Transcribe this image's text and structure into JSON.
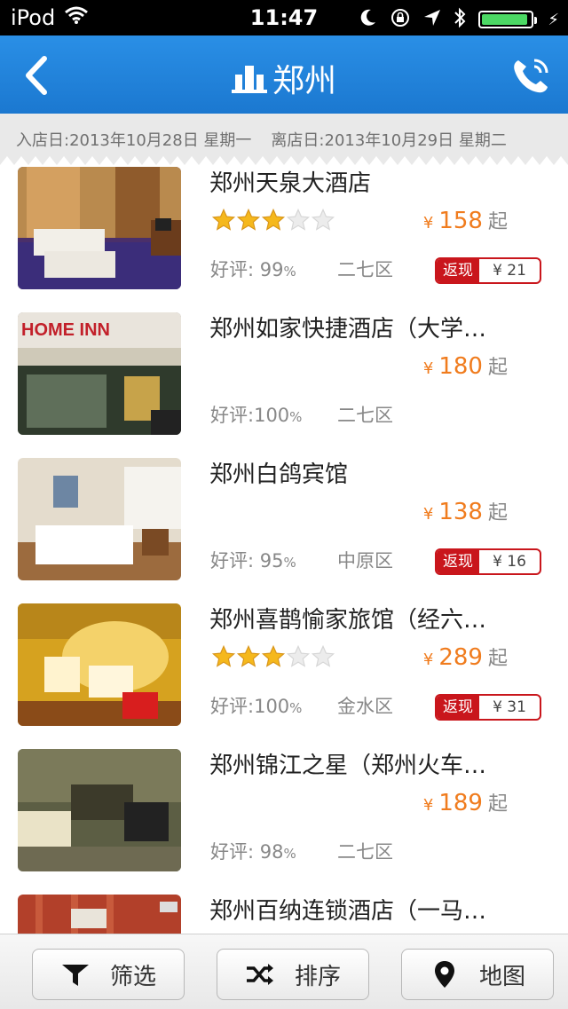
{
  "status_bar": {
    "carrier": "iPod",
    "time": "11:47",
    "battery_level": 0.95
  },
  "nav": {
    "title": "郑州",
    "back_icon": "chevron-left-icon",
    "phone_icon": "phone-icon"
  },
  "dates": {
    "checkin_label": "入店日:",
    "checkin_value": "2013年10月28日 星期一",
    "checkout_label": "离店日:",
    "checkout_value": "2013年10月29日 星期二"
  },
  "hotels": [
    {
      "name": "郑州天泉大酒店",
      "stars": 3,
      "price_symbol": "¥",
      "price": "158",
      "price_suffix": "起",
      "rating_label": "好评:",
      "rating_value": "99",
      "rating_unit": "%",
      "district": "二七区",
      "rebate_label": "返现",
      "rebate_value": "¥ 21"
    },
    {
      "name": "郑州如家快捷酒店（大学…",
      "stars": 0,
      "price_symbol": "¥",
      "price": "180",
      "price_suffix": "起",
      "rating_label": "好评:",
      "rating_value": "100",
      "rating_unit": "%",
      "district": "二七区",
      "thumb_sign": "HOME INN"
    },
    {
      "name": "郑州白鸽宾馆",
      "stars": 0,
      "price_symbol": "¥",
      "price": "138",
      "price_suffix": "起",
      "rating_label": "好评:",
      "rating_value": "95",
      "rating_unit": "%",
      "district": "中原区",
      "rebate_label": "返现",
      "rebate_value": "¥ 16"
    },
    {
      "name": "郑州喜鹊愉家旅馆（经六…",
      "stars": 3,
      "price_symbol": "¥",
      "price": "289",
      "price_suffix": "起",
      "rating_label": "好评:",
      "rating_value": "100",
      "rating_unit": "%",
      "district": "金水区",
      "rebate_label": "返现",
      "rebate_value": "¥ 31"
    },
    {
      "name": "郑州锦江之星（郑州火车…",
      "stars": 0,
      "price_symbol": "¥",
      "price": "189",
      "price_suffix": "起",
      "rating_label": "好评:",
      "rating_value": "98",
      "rating_unit": "%",
      "district": "二七区"
    },
    {
      "name": "郑州百纳连锁酒店（一马…"
    }
  ],
  "toolbar": {
    "filter_label": "筛选",
    "filter_icon": "filter-icon",
    "sort_label": "排序",
    "sort_icon": "shuffle-icon",
    "map_label": "地图",
    "map_icon": "map-pin-icon"
  },
  "colors": {
    "nav_blue": "#1f82dc",
    "price_orange": "#f07c1e",
    "rebate_red": "#c9161c",
    "star_gold": "#f5b81c"
  }
}
